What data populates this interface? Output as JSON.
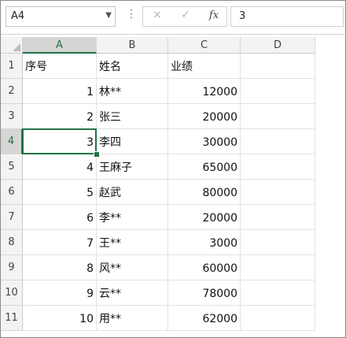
{
  "formula_bar": {
    "name_box": "A4",
    "cancel_icon": "×",
    "enter_icon": "✓",
    "fx_label": "fx",
    "formula_value": "3"
  },
  "columns": [
    "A",
    "B",
    "C",
    "D"
  ],
  "selected_column": "A",
  "selected_row": "4",
  "rows": [
    {
      "num": "1",
      "a": "序号",
      "b": "姓名",
      "c": "业绩"
    },
    {
      "num": "2",
      "a": "1",
      "b": "林**",
      "c": "12000"
    },
    {
      "num": "3",
      "a": "2",
      "b": "张三",
      "c": "20000"
    },
    {
      "num": "4",
      "a": "3",
      "b": "李四",
      "c": "30000"
    },
    {
      "num": "5",
      "a": "4",
      "b": "王麻子",
      "c": "65000"
    },
    {
      "num": "6",
      "a": "5",
      "b": "赵武",
      "c": "80000"
    },
    {
      "num": "7",
      "a": "6",
      "b": "李**",
      "c": "20000"
    },
    {
      "num": "8",
      "a": "7",
      "b": "王**",
      "c": "3000"
    },
    {
      "num": "9",
      "a": "8",
      "b": "风**",
      "c": "60000"
    },
    {
      "num": "10",
      "a": "9",
      "b": "云**",
      "c": "78000"
    },
    {
      "num": "11",
      "a": "10",
      "b": "用**",
      "c": "62000"
    }
  ],
  "colors": {
    "selection": "#217346",
    "header_bg": "#f3f3f3"
  }
}
